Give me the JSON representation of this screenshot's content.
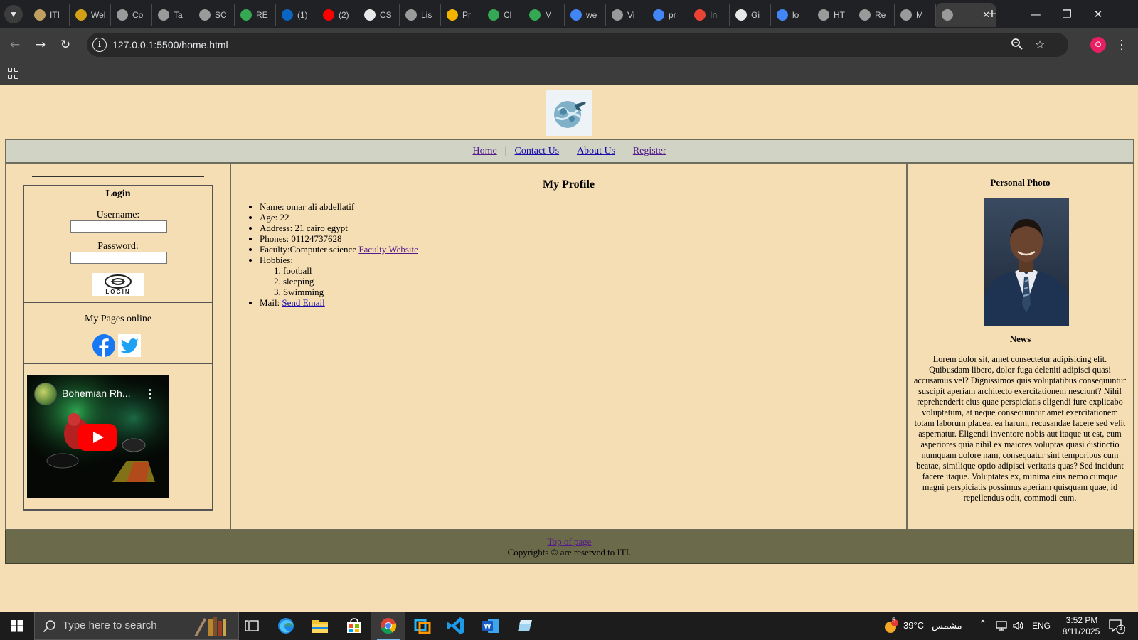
{
  "browser": {
    "tabs": [
      {
        "label": "ITI",
        "icon": "iti-favicon",
        "color": "#c0a060"
      },
      {
        "label": "Wel",
        "icon": "smiley-favicon",
        "color": "#d4a017"
      },
      {
        "label": "Co",
        "icon": "chatgpt-favicon",
        "color": "#9a9a9a"
      },
      {
        "label": "Ta",
        "icon": "chatgpt-favicon",
        "color": "#9a9a9a"
      },
      {
        "label": "SC",
        "icon": "chatgpt-favicon",
        "color": "#9a9a9a"
      },
      {
        "label": "RE",
        "icon": "drive-favicon",
        "color": "#34a853"
      },
      {
        "label": "(1)",
        "icon": "linkedin-favicon",
        "color": "#0a66c2"
      },
      {
        "label": "(2)",
        "icon": "youtube-favicon",
        "color": "#ff0000"
      },
      {
        "label": "CS",
        "icon": "notion-favicon",
        "color": "#e8e8e8"
      },
      {
        "label": "Lis",
        "icon": "chatgpt-favicon",
        "color": "#9a9a9a"
      },
      {
        "label": "Pr",
        "icon": "chart-favicon",
        "color": "#f4b400"
      },
      {
        "label": "Cl",
        "icon": "drive-favicon",
        "color": "#34a853"
      },
      {
        "label": "M",
        "icon": "drive-favicon",
        "color": "#34a853"
      },
      {
        "label": "we",
        "icon": "google-favicon",
        "color": "#4285f4"
      },
      {
        "label": "Vi",
        "icon": "chatgpt-favicon",
        "color": "#9a9a9a"
      },
      {
        "label": "pr",
        "icon": "google-favicon",
        "color": "#4285f4"
      },
      {
        "label": "In",
        "icon": "gmail-favicon",
        "color": "#ea4335"
      },
      {
        "label": "Gi",
        "icon": "github-favicon",
        "color": "#e8e8e8"
      },
      {
        "label": "lo",
        "icon": "google-favicon",
        "color": "#4285f4"
      },
      {
        "label": "HT",
        "icon": "chatgpt-favicon",
        "color": "#9a9a9a"
      },
      {
        "label": "Re",
        "icon": "globe-favicon",
        "color": "#9a9a9a"
      },
      {
        "label": "M",
        "icon": "chatgpt-favicon",
        "color": "#9a9a9a"
      }
    ],
    "url": "127.0.0.1:5500/home.html",
    "profile_initial": "O"
  },
  "page": {
    "nav": {
      "home": "Home",
      "contact": "Contact Us",
      "about": "About Us",
      "register": "Register",
      "separator": "|"
    },
    "login": {
      "title": "Login",
      "username_label": "Username:",
      "password_label": "Password:",
      "button_text": "LOGIN"
    },
    "pages_online": {
      "title": "My Pages online"
    },
    "video": {
      "title": "Bohemian Rh..."
    },
    "profile": {
      "title": "My Profile",
      "name": "Name: omar ali abdellatif",
      "age": "Age: 22",
      "address": "Address: 21 cairo egypt",
      "phones": "Phones: 01124737628",
      "faculty_prefix": "Faculty:Computer science",
      "faculty_link": "Faculty Website",
      "hobbies_label": "Hobbies:",
      "hobbies": [
        "football",
        "sleeping",
        "Swimming"
      ],
      "mail_label": "Mail:",
      "mail_link": "Send Email"
    },
    "right": {
      "photo_title": "Personal Photo",
      "news_title": "News",
      "news_text": "Lorem dolor sit, amet consectetur adipisicing elit. Quibusdam libero, dolor fuga deleniti adipisci quasi accusamus vel? Dignissimos quis voluptatibus consequuntur suscipit aperiam architecto exercitationem nesciunt? Nihil reprehenderit eius quae perspiciatis eligendi iure explicabo voluptatum, at neque consequuntur amet exercitationem totam laborum placeat ea harum, recusandae facere sed velit aspernatur. Eligendi inventore nobis aut itaque ut est, eum asperiores quia nihil ex maiores voluptas quasi distinctio numquam dolore nam, consequatur sint temporibus cum beatae, similique optio adipisci veritatis quas? Sed incidunt facere itaque. Voluptates ex, minima eius nemo cumque magni perspiciatis possimus aperiam quisquam quae, id repellendus odit, commodi eum."
    },
    "footer": {
      "top_link": "Top of page",
      "copyright": "Copyrights © are reserved to ITI."
    }
  },
  "taskbar": {
    "search_placeholder": "Type here to search",
    "weather_temp": "39°C",
    "weather_desc": "مشمس",
    "weather_badge": "5",
    "language": "ENG",
    "time": "3:52 PM",
    "date": "8/11/2025",
    "notification_count": "3"
  }
}
